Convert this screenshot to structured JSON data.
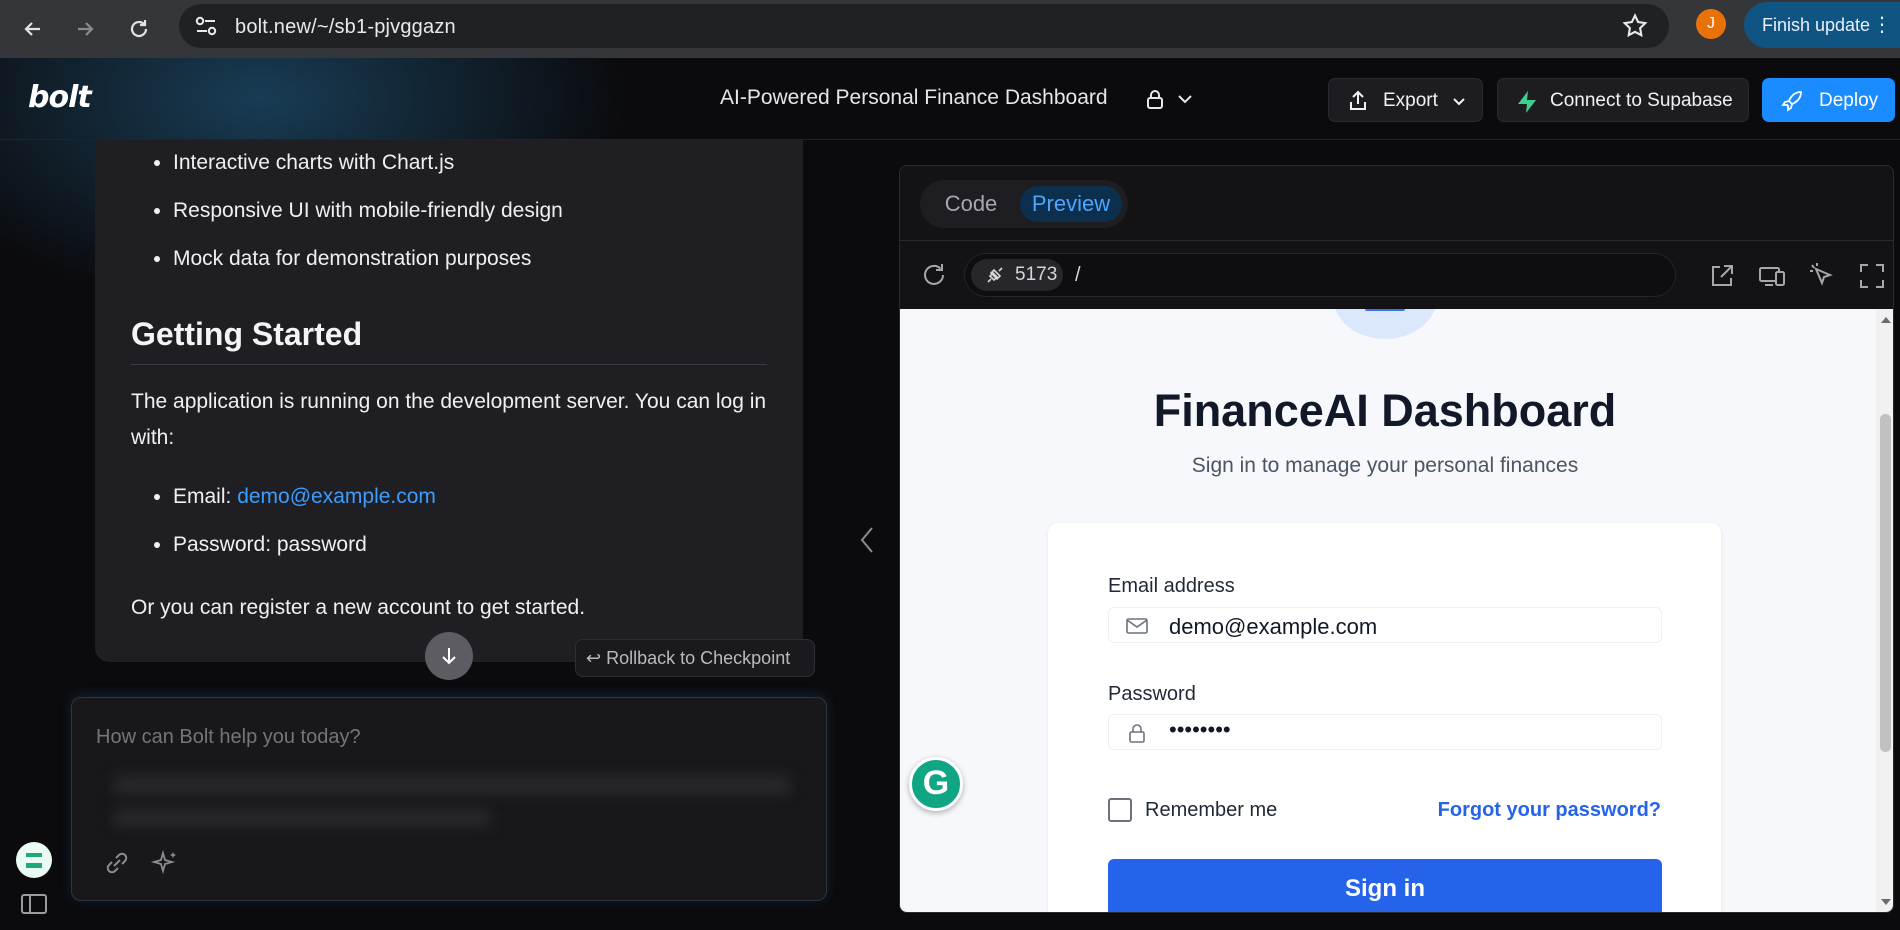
{
  "browser": {
    "url": "bolt.new/~/sb1-pjvggazn",
    "profile_initial": "J",
    "finish_update_label": "Finish update"
  },
  "header": {
    "logo": "bolt",
    "project_title": "AI-Powered Personal Finance Dashboard",
    "export_label": "Export",
    "supabase_label": "Connect to Supabase",
    "deploy_label": "Deploy"
  },
  "chat": {
    "bullets": [
      "Interactive charts with Chart.js",
      "Responsive UI with mobile-friendly design",
      "Mock data for demonstration purposes"
    ],
    "heading": "Getting Started",
    "intro": "The application is running on the development server. You can log in with:",
    "email_prefix": "Email: ",
    "email_link": "demo@example.com",
    "password_line": "Password: password",
    "outro": "Or you can register a new account to get started.",
    "rollback_label": "Rollback to Checkpoint",
    "prompt_placeholder": "How can Bolt help you today?"
  },
  "workbench": {
    "tab_code": "Code",
    "tab_preview": "Preview",
    "port": "5173",
    "path": "/"
  },
  "preview": {
    "title": "FinanceAI Dashboard",
    "subtitle": "Sign in to manage your personal finances",
    "email_label": "Email address",
    "email_value": "demo@example.com",
    "password_label": "Password",
    "password_value": "••••••••",
    "remember_label": "Remember me",
    "forgot_label": "Forgot your password?",
    "signin_label": "Sign in"
  },
  "colors": {
    "accent": "#1a8cff",
    "signin": "#2563eb",
    "preview_tab": "#4aa6ff"
  }
}
